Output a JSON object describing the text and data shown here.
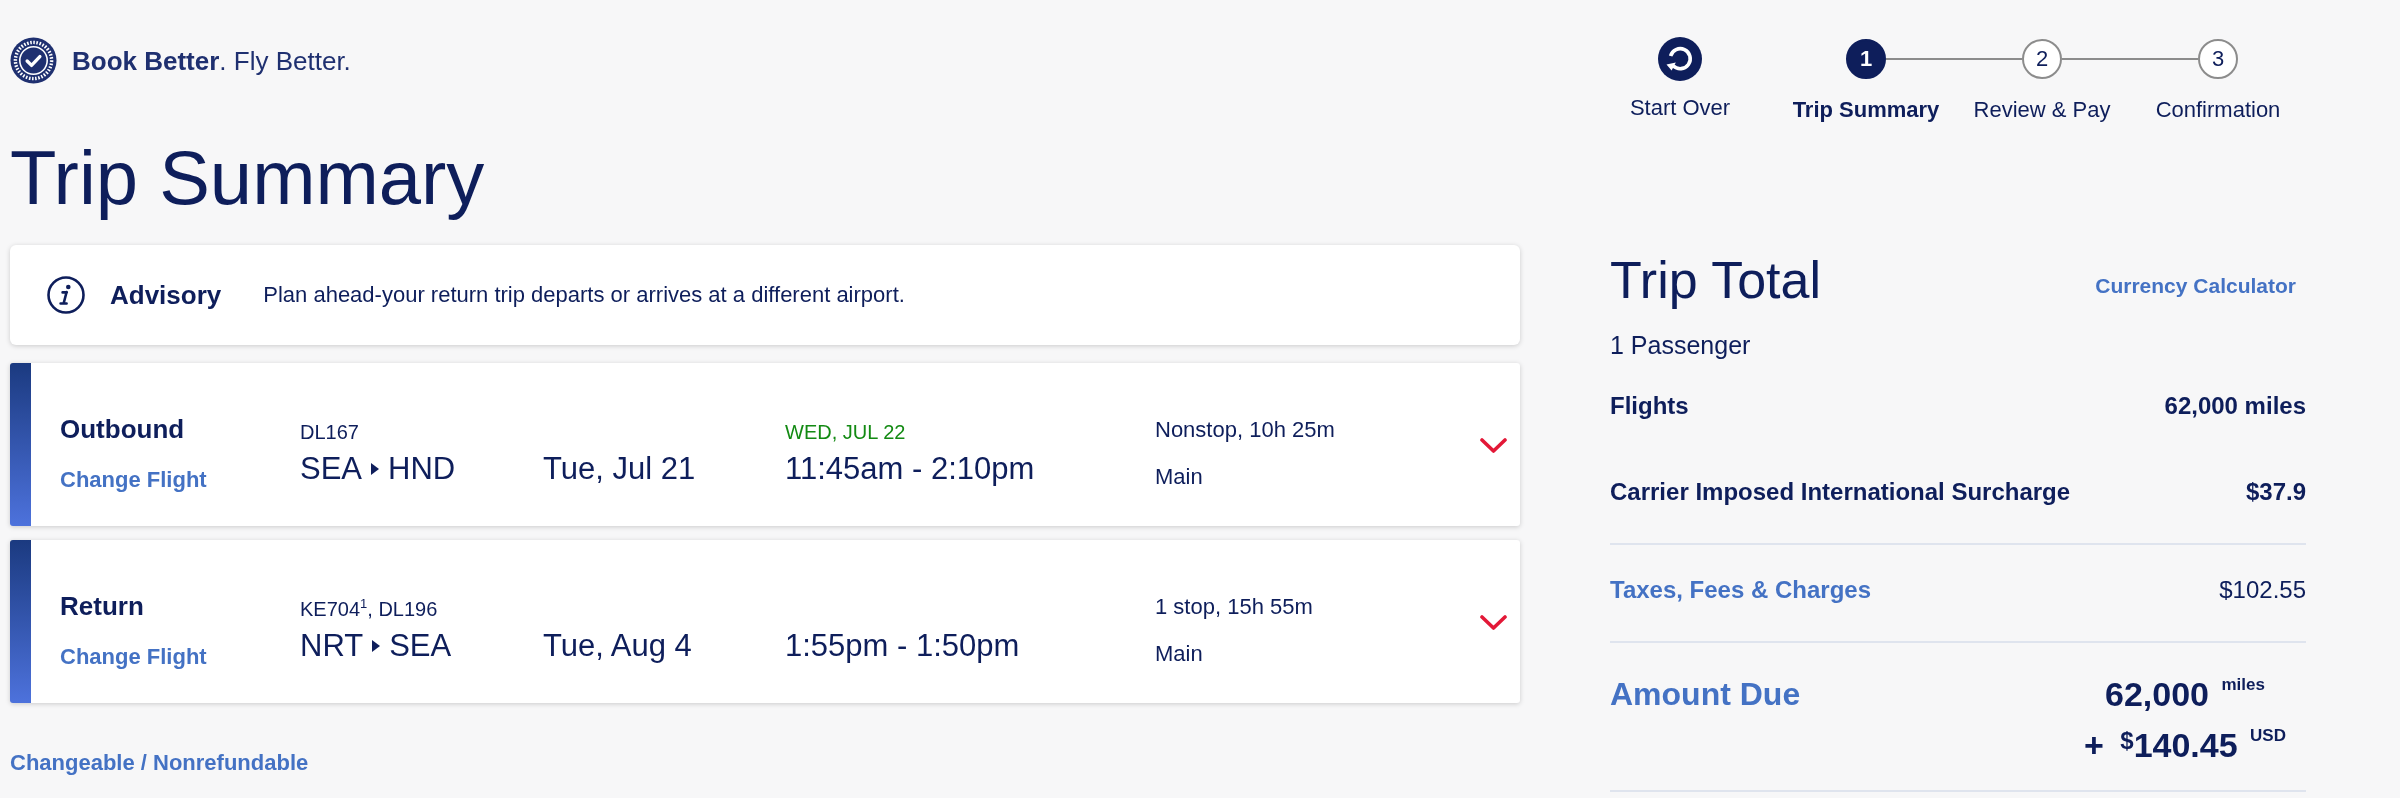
{
  "logo": {
    "tagline": "**Book Better**. Fly Better."
  },
  "stepper": {
    "start_over": "Start Over",
    "steps": [
      {
        "number": "1",
        "label": "Trip Summary",
        "selected": true
      },
      {
        "number": "2",
        "label": "Review & Pay",
        "selected": false
      },
      {
        "number": "3",
        "label": "Confirmation",
        "selected": false
      }
    ]
  },
  "page_title": "Trip Summary",
  "advisory": {
    "title": "Advisory",
    "message": "Plan ahead-your return trip departs or arrives at a different airport."
  },
  "flights": [
    {
      "direction": "Outbound",
      "change_link": "Change Flight",
      "flight_number": "DL167",
      "origin": "SEA",
      "destination": "HND",
      "date": "Tue, Jul 21",
      "arrival_note": "WED, JUL 22",
      "times": "11:45am - 2:10pm",
      "stops": "Nonstop, 10h 25m",
      "cabin": "Main",
      "expanded": false
    },
    {
      "direction": "Return",
      "change_link": "Change Flight",
      "flight_number": "KE704$^{1}$, DL196",
      "origin": "NRT",
      "destination": "SEA",
      "date": "Tue, Aug 4",
      "times": "1:55pm - 1:50pm",
      "stops": "1 stop, 15h 55m",
      "cabin": "Main",
      "expanded": false
    }
  ],
  "fare_rules_link": "Changeable / Nonrefundable",
  "trip_total": {
    "title": "Trip Total",
    "link": "Currency Calculator",
    "passengers": "1 Passenger",
    "sections": [
      {
        "lines": [
          {
            "kind": "bold",
            "label": "Flights",
            "value": "62,000 miles"
          },
          {
            "kind": "bold",
            "label": "Carrier Imposed International Surcharge",
            "value": "$37.9"
          }
        ]
      },
      {
        "lines": [
          {
            "kind": "link",
            "label": "Taxes, Fees & Charges",
            "value": "$102.55"
          }
        ]
      }
    ],
    "amount_due": {
      "label": "Amount Due",
      "miles": "62,000",
      "miles_unit": "miles",
      "plus": "+",
      "currency_symbol": "$",
      "amount": "140.45",
      "currency": "USD"
    }
  }
}
